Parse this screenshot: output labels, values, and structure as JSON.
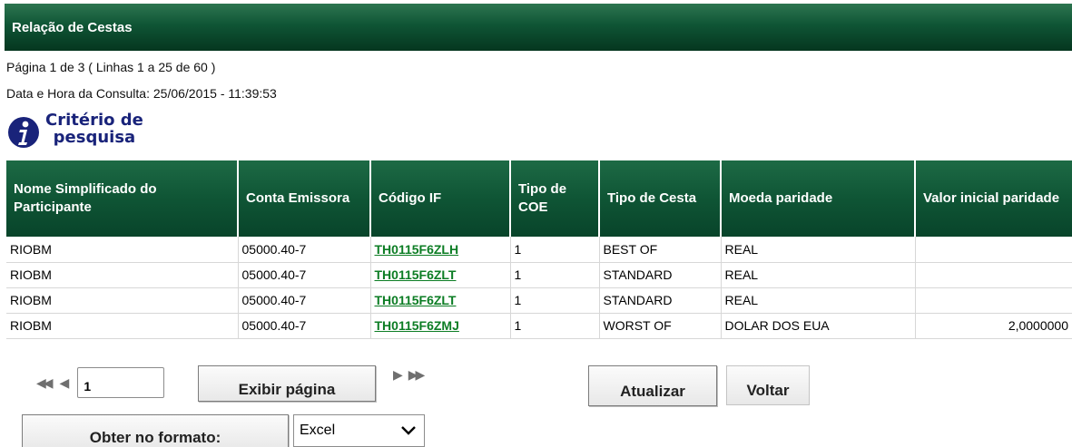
{
  "header": {
    "title": "Relação de Cestas"
  },
  "info": {
    "page_line": "Página 1 de 3 ( Linhas 1 a 25 de 60 )",
    "query_time_line": "Data e Hora da Consulta: 25/06/2015 - 11:39:53"
  },
  "criteria": {
    "line1": "Critério de",
    "line2": "pesquisa",
    "icon": "info-icon"
  },
  "table": {
    "columns": [
      "Nome Simplificado do Participante",
      "Conta Emissora",
      "Código IF",
      "Tipo de COE",
      "Tipo de Cesta",
      "Moeda paridade",
      "Valor inicial paridade"
    ],
    "rows": [
      [
        "RIOBM",
        "05000.40-7",
        "TH0115F6ZLH",
        "1",
        "BEST OF",
        "REAL",
        ""
      ],
      [
        "RIOBM",
        "05000.40-7",
        "TH0115F6ZLT",
        "1",
        "STANDARD",
        "REAL",
        ""
      ],
      [
        "RIOBM",
        "05000.40-7",
        "TH0115F6ZLT",
        "1",
        "STANDARD",
        "REAL",
        ""
      ],
      [
        "RIOBM",
        "05000.40-7",
        "TH0115F6ZMJ",
        "1",
        "WORST OF",
        "DOLAR DOS EUA",
        "2,0000000"
      ]
    ]
  },
  "pager": {
    "first_icon": "double-left-arrow-icon",
    "prev_icon": "left-arrow-icon",
    "next_icon": "right-arrow-icon",
    "last_icon": "double-right-arrow-icon",
    "page_value": "1",
    "show_page_label": "Exibir página"
  },
  "actions": {
    "refresh_label": "Atualizar",
    "back_label": "Voltar",
    "export_label": "Obter no formato:",
    "format_selected": "Excel"
  },
  "colors": {
    "header_green": "#0f5535",
    "link_green": "#0c7d24",
    "criteria_blue": "#19237a"
  }
}
